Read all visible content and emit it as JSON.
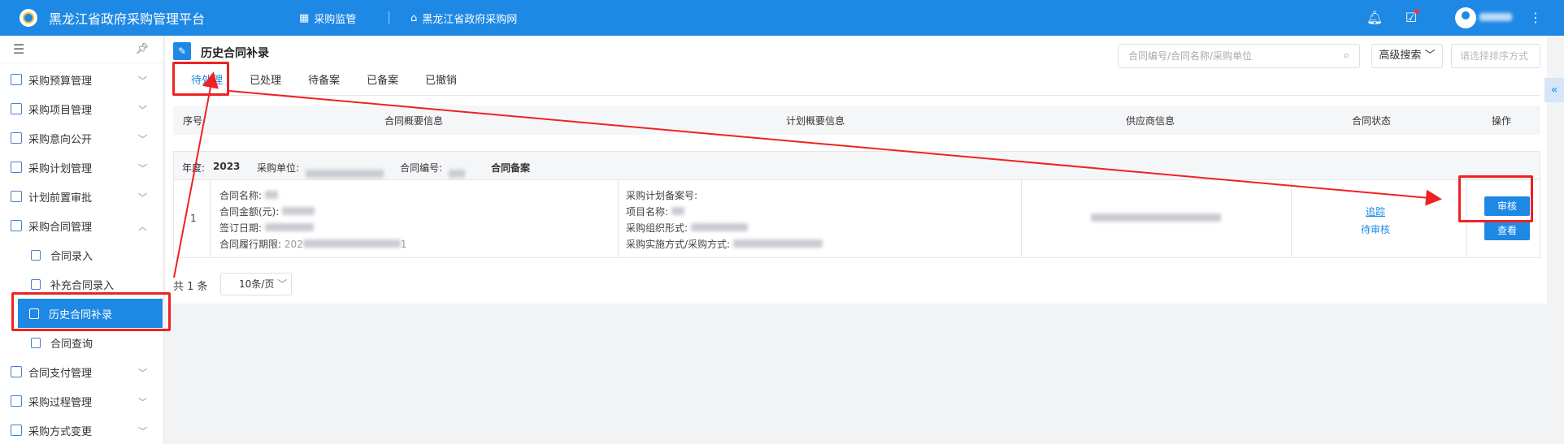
{
  "header": {
    "app_title": "黑龙江省政府采购管理平台",
    "nav_monitor": "采购监管",
    "nav_site": "黑龙江省政府采购网"
  },
  "sidebar": {
    "items": [
      {
        "label": "采购预算管理",
        "icon": "budget-icon"
      },
      {
        "label": "采购项目管理",
        "icon": "project-icon"
      },
      {
        "label": "采购意向公开",
        "icon": "intent-icon"
      },
      {
        "label": "采购计划管理",
        "icon": "plan-icon"
      },
      {
        "label": "计划前置审批",
        "icon": "approval-icon"
      },
      {
        "label": "采购合同管理",
        "icon": "contract-icon"
      }
    ],
    "sub_items": [
      {
        "label": "合同录入"
      },
      {
        "label": "补充合同录入"
      },
      {
        "label": "历史合同补录"
      },
      {
        "label": "合同查询"
      }
    ],
    "items_after": [
      {
        "label": "合同支付管理"
      },
      {
        "label": "采购过程管理"
      },
      {
        "label": "采购方式变更"
      }
    ]
  },
  "page": {
    "title": "历史合同补录",
    "search_placeholder": "合同编号/合同名称/采购单位",
    "advanced_search": "高级搜索",
    "sort_placeholder": "请选择排序方式",
    "tabs": [
      "待处理",
      "已处理",
      "待备案",
      "已备案",
      "已撤销"
    ],
    "columns": [
      "序号",
      "合同概要信息",
      "计划概要信息",
      "供应商信息",
      "合同状态",
      "操作"
    ]
  },
  "group": {
    "year_label": "年度:",
    "year_value": "2023",
    "unit_label": "采购单位:",
    "contract_no_label": "合同编号:",
    "tag": "合同备案"
  },
  "row": {
    "index": "1",
    "contract_name": "合同名称:",
    "contract_amount": "合同金额(元):",
    "sign_date": "签订日期:",
    "period": "合同履行期限:",
    "period_val_a": "202",
    "period_val_b": "1",
    "plan_no": "采购计划备案号:",
    "project_name": "项目名称:",
    "org_form": "采购组织形式:",
    "method": "采购实施方式/采购方式:",
    "status_link": "追踪",
    "status_text": "待审核",
    "btn_review": "审核",
    "btn_view": "查看"
  },
  "pager": {
    "total": "共 1 条",
    "page_size": "10条/页"
  },
  "colors": {
    "primary": "#1e88e5",
    "annotation": "#ee2222"
  }
}
